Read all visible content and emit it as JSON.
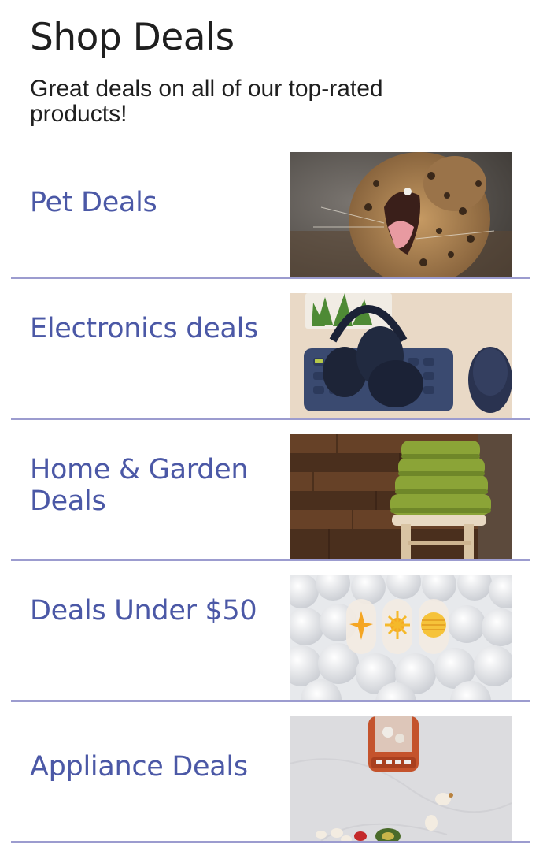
{
  "header": {
    "title": "Shop Deals",
    "subtitle": "Great deals on all of our top-rated products!"
  },
  "deals": [
    {
      "label": "Pet Deals",
      "image": "leopard-yawning-photo"
    },
    {
      "label": "Electronics deals",
      "image": "headphones-keyboard-mouse-photo"
    },
    {
      "label": "Home & Garden Deals",
      "image": "green-towels-on-stool-photo"
    },
    {
      "label": "Deals Under $50",
      "image": "white-balls-yellow-shapes-photo"
    },
    {
      "label": "Appliance Deals",
      "image": "blender-with-ingredients-photo"
    }
  ],
  "colors": {
    "link": "#4b58a6",
    "divider": "#9c9ccf",
    "heading": "#1f1f1f"
  }
}
